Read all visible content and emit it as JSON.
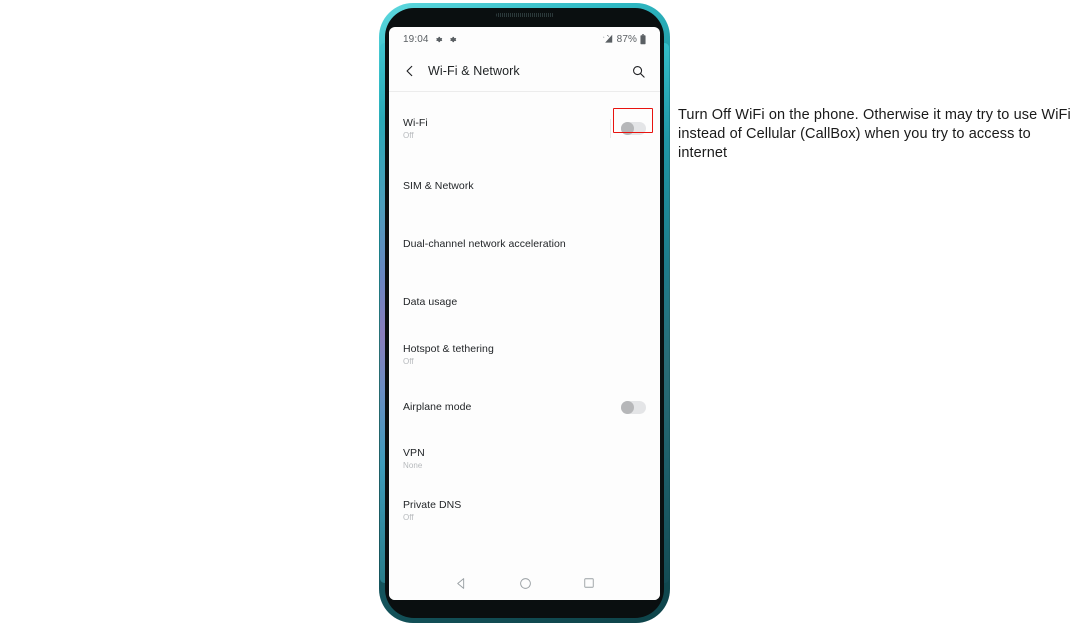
{
  "annotation": {
    "text": "Turn Off WiFi on the phone. Otherwise it may try to use WiFi instead of Cellular (CallBox) when you try to access to internet",
    "highlight_color": "#e8130f"
  },
  "phone": {
    "frame_color": "#17848f",
    "statusbar": {
      "time": "19:04",
      "icons_left": [
        "gear-icon",
        "gear-icon"
      ],
      "signal_icon": "cellular-signal-icon",
      "battery_percent": "87%",
      "battery_icon": "battery-icon"
    },
    "appbar": {
      "back_icon": "back-chevron-icon",
      "title": "Wi-Fi & Network",
      "search_icon": "search-icon"
    },
    "settings": [
      {
        "title": "Wi-Fi",
        "subtitle": "Off",
        "control": "toggle",
        "toggle_state": "off",
        "highlighted": true
      },
      {
        "title": "SIM & Network",
        "subtitle": "",
        "control": "none",
        "toggle_state": "",
        "highlighted": false
      },
      {
        "title": "Dual-channel network acceleration",
        "subtitle": "",
        "control": "none",
        "toggle_state": "",
        "highlighted": false
      },
      {
        "title": "Data usage",
        "subtitle": "",
        "control": "none",
        "toggle_state": "",
        "highlighted": false
      },
      {
        "title": "Hotspot & tethering",
        "subtitle": "Off",
        "control": "none",
        "toggle_state": "",
        "highlighted": false
      },
      {
        "title": "Airplane mode",
        "subtitle": "",
        "control": "toggle",
        "toggle_state": "off",
        "highlighted": false
      },
      {
        "title": "VPN",
        "subtitle": "None",
        "control": "none",
        "toggle_state": "",
        "highlighted": false
      },
      {
        "title": "Private DNS",
        "subtitle": "Off",
        "control": "none",
        "toggle_state": "",
        "highlighted": false
      }
    ],
    "navbar": {
      "back": "nav-back-triangle-icon",
      "home": "nav-home-circle-icon",
      "recents": "nav-recents-square-icon"
    }
  }
}
